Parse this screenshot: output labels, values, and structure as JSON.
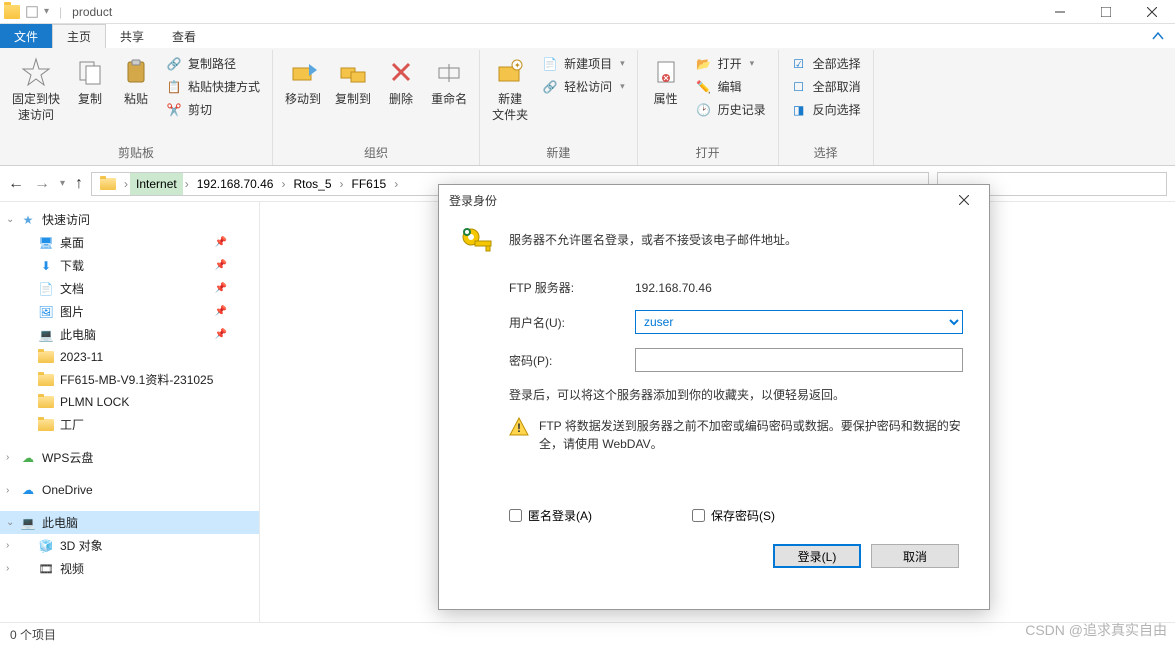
{
  "titlebar": {
    "title": "product"
  },
  "ribbon_tabs": {
    "file": "文件",
    "home": "主页",
    "share": "共享",
    "view": "查看"
  },
  "ribbon": {
    "clipboard": {
      "pin": "固定到快\n速访问",
      "copy": "复制",
      "paste": "粘贴",
      "copy_path": "复制路径",
      "paste_shortcut": "粘贴快捷方式",
      "cut": "剪切",
      "label": "剪贴板"
    },
    "organize": {
      "move_to": "移动到",
      "copy_to": "复制到",
      "delete": "删除",
      "rename": "重命名",
      "label": "组织"
    },
    "new": {
      "new_folder": "新建\n文件夹",
      "new_item": "新建项目",
      "easy_access": "轻松访问",
      "label": "新建"
    },
    "open": {
      "properties": "属性",
      "open": "打开",
      "edit": "编辑",
      "history": "历史记录",
      "label": "打开"
    },
    "select": {
      "select_all": "全部选择",
      "select_none": "全部取消",
      "invert": "反向选择",
      "label": "选择"
    }
  },
  "breadcrumb": {
    "items": [
      "Internet",
      "192.168.70.46",
      "Rtos_5",
      "FF615"
    ]
  },
  "sidebar": {
    "quick": "快速访问",
    "pinned": [
      {
        "name": "桌面"
      },
      {
        "name": "下载"
      },
      {
        "name": "文档"
      },
      {
        "name": "图片"
      },
      {
        "name": "此电脑"
      }
    ],
    "recent": [
      {
        "name": "2023-11"
      },
      {
        "name": "FF615-MB-V9.1资料-231025"
      },
      {
        "name": "PLMN LOCK"
      },
      {
        "name": "工厂"
      }
    ],
    "wps": "WPS云盘",
    "onedrive": "OneDrive",
    "thispc": "此电脑",
    "pc_items": [
      {
        "name": "3D 对象"
      },
      {
        "name": "视频"
      }
    ]
  },
  "status": {
    "items": "0 个项目"
  },
  "dialog": {
    "title": "登录身份",
    "message": "服务器不允许匿名登录，或者不接受该电子邮件地址。",
    "server_label": "FTP 服务器:",
    "server_value": "192.168.70.46",
    "user_label": "用户名(U):",
    "user_value": "zuser",
    "pass_label": "密码(P):",
    "note": "登录后，可以将这个服务器添加到你的收藏夹，以便轻易返回。",
    "warning": "FTP 将数据发送到服务器之前不加密或编码密码或数据。要保护密码和数据的安全，请使用 WebDAV。",
    "anonymous": "匿名登录(A)",
    "save_pass": "保存密码(S)",
    "login": "登录(L)",
    "cancel": "取消"
  },
  "watermark": "CSDN @追求真实自由"
}
